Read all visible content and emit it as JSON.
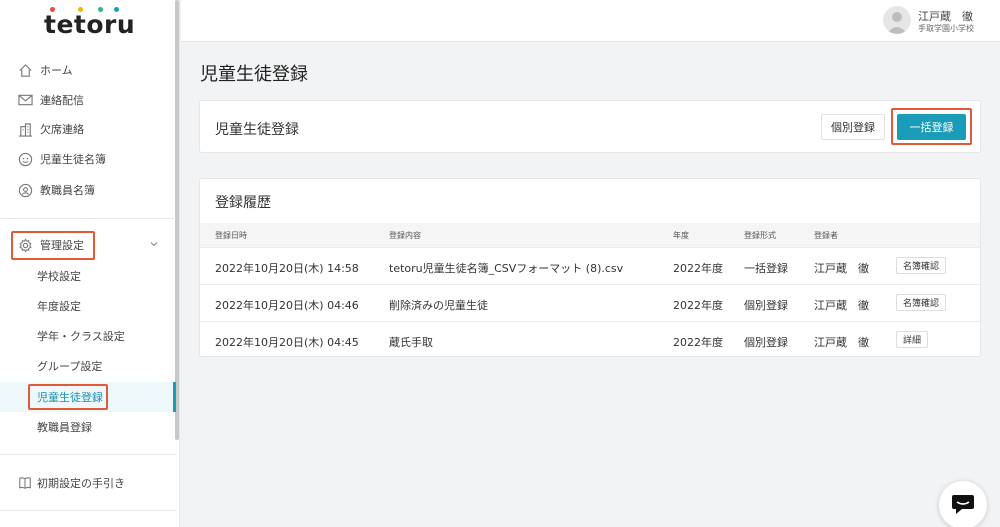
{
  "brand": {
    "logo": "tetoru",
    "dot_colors": [
      "#e94b3c",
      "#f5b400",
      "#2bb673",
      "#1a9bb8"
    ]
  },
  "sidebar": {
    "nav": [
      {
        "label": "ホーム",
        "icon": "home-icon"
      },
      {
        "label": "連絡配信",
        "icon": "mail-icon"
      },
      {
        "label": "欠席連絡",
        "icon": "building-icon"
      },
      {
        "label": "児童生徒名簿",
        "icon": "face-icon"
      },
      {
        "label": "教職員名簿",
        "icon": "staff-icon"
      }
    ],
    "admin": {
      "label": "管理設定",
      "icon": "gear-icon"
    },
    "sub_items": [
      {
        "label": "学校設定"
      },
      {
        "label": "年度設定"
      },
      {
        "label": "学年・クラス設定"
      },
      {
        "label": "グループ設定"
      },
      {
        "label": "児童生徒登録"
      },
      {
        "label": "教職員登録"
      }
    ],
    "guide": {
      "label": "初期設定の手引き",
      "icon": "book-icon"
    }
  },
  "topbar": {
    "user_name": "江戸蔵　徹",
    "school": "手取学園小学校"
  },
  "page": {
    "title": "児童生徒登録",
    "register_card": {
      "title": "児童生徒登録",
      "individual_button": "個別登録",
      "bulk_button": "一括登録"
    },
    "history": {
      "title": "登録履歴",
      "columns": [
        "登録日時",
        "登録内容",
        "年度",
        "登録形式",
        "登録者"
      ],
      "rows": [
        {
          "datetime": "2022年10月20日(木) 14:58",
          "content": "tetoru児童生徒名簿_CSVフォーマット (8).csv",
          "year": "2022年度",
          "type": "一括登録",
          "user": "江戸蔵　徹",
          "action": "名簿確認"
        },
        {
          "datetime": "2022年10月20日(木) 04:46",
          "content": "削除済みの児童生徒",
          "year": "2022年度",
          "type": "個別登録",
          "user": "江戸蔵　徹",
          "action": "名簿確認"
        },
        {
          "datetime": "2022年10月20日(木) 04:45",
          "content": "蔵氏手取",
          "year": "2022年度",
          "type": "個別登録",
          "user": "江戸蔵　徹",
          "action": "詳細"
        }
      ]
    }
  },
  "colors": {
    "accent": "#1a9cb8",
    "highlight_box": "#e05a3a"
  }
}
